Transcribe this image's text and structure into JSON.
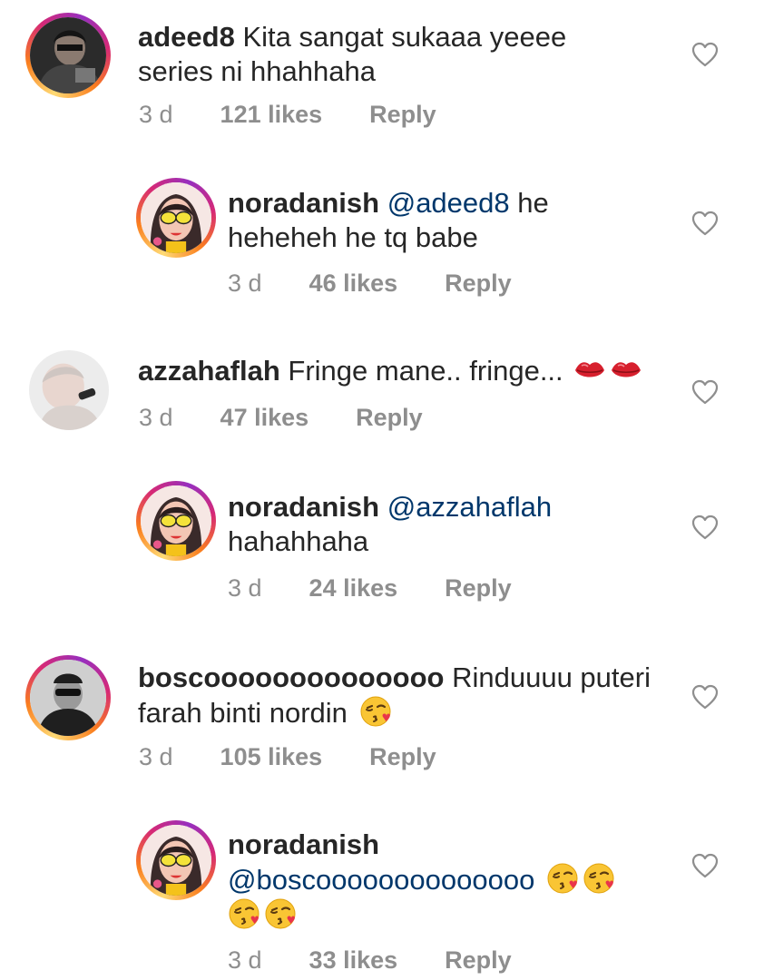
{
  "comments": [
    {
      "username": "adeed8",
      "text_line1": "Kita sangat sukaaa yeeee",
      "text_line2": "series ni hhahhaha",
      "time": "3 d",
      "likes": "121 likes",
      "reply": "Reply",
      "avatar": "dark-photo"
    },
    {
      "username": "noradanish",
      "mention": "@adeed8",
      "text_line1_rest": "he",
      "text_line2": "heheheh he tq babe",
      "time": "3 d",
      "likes": "46 likes",
      "reply": "Reply",
      "avatar": "illustrated-girl"
    },
    {
      "username": "azzahaflah",
      "text_line1": "Fringe mane.. fringe...",
      "emoji": "kiss-mark-lips-x2",
      "time": "3 d",
      "likes": "47 likes",
      "reply": "Reply",
      "avatar": "light-photo"
    },
    {
      "username": "noradanish",
      "mention": "@azzahaflah",
      "text_line2": "hahahhaha",
      "time": "3 d",
      "likes": "24 likes",
      "reply": "Reply",
      "avatar": "illustrated-girl"
    },
    {
      "username": "boscoooooooooooooo",
      "text_line1": "Rinduuuu puteri",
      "text_line2": "farah binti nordin",
      "emoji": "face-blowing-kiss",
      "time": "3 d",
      "likes": "105 likes",
      "reply": "Reply",
      "avatar": "bw-photo"
    },
    {
      "username": "noradanish",
      "mention": "@boscoooooooooooooo",
      "emoji": "face-blowing-kiss-x4",
      "time": "3 d",
      "likes": "33 likes",
      "reply": "Reply",
      "avatar": "illustrated-girl"
    }
  ],
  "colors": {
    "text": "#262626",
    "secondary": "#8e8e8e",
    "mention": "#00376b",
    "heart_outline": "#8e8e8e"
  },
  "icons": {
    "like": "heart-outline-icon"
  }
}
